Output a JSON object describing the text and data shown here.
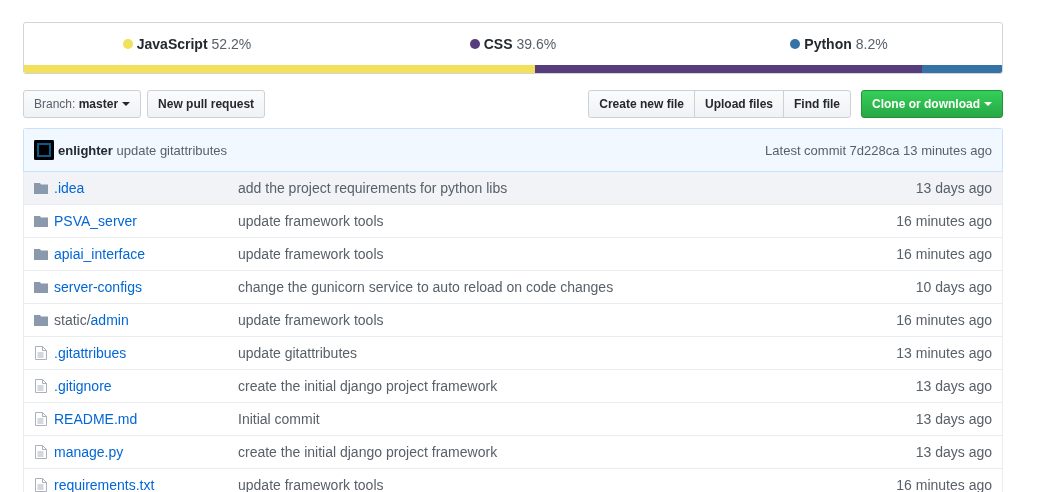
{
  "languages": [
    {
      "name": "JavaScript",
      "percent": "52.2%",
      "color": "#f1e05a"
    },
    {
      "name": "CSS",
      "percent": "39.6%",
      "color": "#563d7c"
    },
    {
      "name": "Python",
      "percent": "8.2%",
      "color": "#3572a5"
    }
  ],
  "branch": {
    "label": "Branch:",
    "value": "master"
  },
  "new_pull_request": "New pull request",
  "file_buttons": [
    "Create new file",
    "Upload files",
    "Find file"
  ],
  "clone_button": "Clone or download",
  "commit": {
    "author": "enlighter",
    "message": "update gitattributes",
    "latest": "Latest commit 7d228ca 13 minutes ago"
  },
  "files": [
    {
      "kind": "folder",
      "name": ".idea",
      "message": "add the project requirements for python libs",
      "age": "13 days ago",
      "selected": true
    },
    {
      "kind": "folder",
      "name": "PSVA_server",
      "message": "update framework tools",
      "age": "16 minutes ago",
      "selected": false
    },
    {
      "kind": "folder",
      "name": "apiai_interface",
      "message": "update framework tools",
      "age": "16 minutes ago",
      "selected": false
    },
    {
      "kind": "folder",
      "name": "server-configs",
      "message": "change the gunicorn service to auto reload on code changes",
      "age": "10 days ago",
      "selected": false
    },
    {
      "kind": "folder",
      "prefix": "static/",
      "name": "admin",
      "message": "update framework tools",
      "age": "16 minutes ago",
      "selected": false
    },
    {
      "kind": "file",
      "name": ".gitattribues",
      "message": "update gitattributes",
      "age": "13 minutes ago",
      "selected": false
    },
    {
      "kind": "file",
      "name": ".gitignore",
      "message": "create the initial django project framework",
      "age": "13 days ago",
      "selected": false
    },
    {
      "kind": "file",
      "name": "README.md",
      "message": "Initial commit",
      "age": "13 days ago",
      "selected": false
    },
    {
      "kind": "file",
      "name": "manage.py",
      "message": "create the initial django project framework",
      "age": "13 days ago",
      "selected": false
    },
    {
      "kind": "file",
      "name": "requirements.txt",
      "message": "update framework tools",
      "age": "16 minutes ago",
      "selected": false
    }
  ]
}
